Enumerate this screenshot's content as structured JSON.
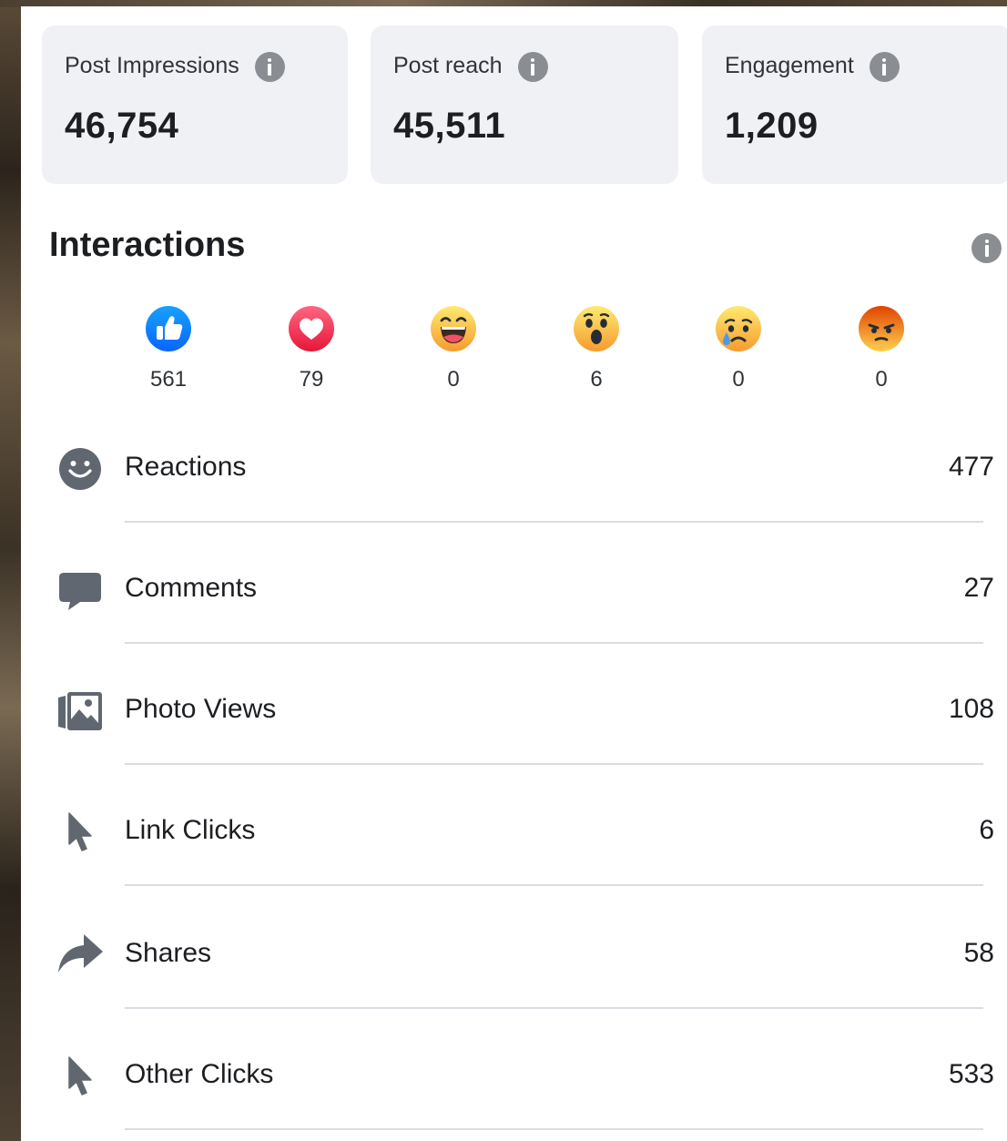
{
  "stats": [
    {
      "label": "Post Impressions",
      "value": "46,754"
    },
    {
      "label": "Post reach",
      "value": "45,511"
    },
    {
      "label": "Engagement",
      "value": "1,209"
    }
  ],
  "interactions": {
    "title": "Interactions",
    "reactions": [
      {
        "type": "like",
        "icon": "like-icon",
        "count": "561",
        "color": "#1877f2"
      },
      {
        "type": "love",
        "icon": "love-icon",
        "count": "79",
        "color": "#f33e58"
      },
      {
        "type": "haha",
        "icon": "haha-icon",
        "count": "0",
        "color": "#f7b125"
      },
      {
        "type": "wow",
        "icon": "wow-icon",
        "count": "6",
        "color": "#f7b125"
      },
      {
        "type": "sad",
        "icon": "sad-icon",
        "count": "0",
        "color": "#f7b125"
      },
      {
        "type": "angry",
        "icon": "angry-icon",
        "count": "0",
        "color": "#e9710f"
      }
    ],
    "metrics": [
      {
        "icon": "smiley-icon",
        "label": "Reactions",
        "value": "477"
      },
      {
        "icon": "comment-icon",
        "label": "Comments",
        "value": "27"
      },
      {
        "icon": "photo-icon",
        "label": "Photo Views",
        "value": "108"
      },
      {
        "icon": "cursor-icon",
        "label": "Link Clicks",
        "value": "6"
      },
      {
        "icon": "share-icon",
        "label": "Shares",
        "value": "58"
      },
      {
        "icon": "cursor-icon",
        "label": "Other Clicks",
        "value": "533"
      }
    ]
  }
}
